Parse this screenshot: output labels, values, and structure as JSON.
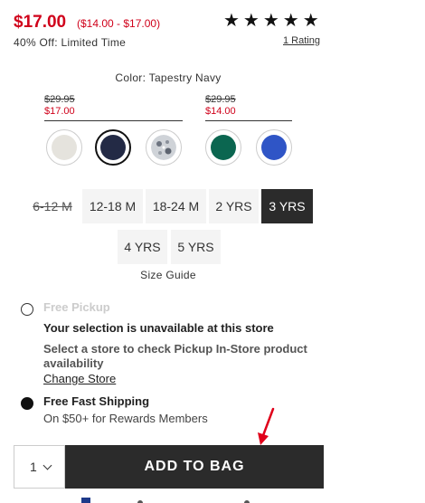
{
  "product": {
    "price": "$17.00",
    "price_range": "($14.00 - $17.00)",
    "discount": "40% Off: Limited Time",
    "stars": "★★★★★",
    "rating_value": 5,
    "rating_link": "1 Rating"
  },
  "color": {
    "label": "Color: Tapestry Navy",
    "groups": [
      {
        "old": "$29.95",
        "new": "$17.00"
      },
      {
        "old": "$29.95",
        "new": "$14.00"
      }
    ],
    "swatches": [
      {
        "name": "cream",
        "color": "#e5e3dd"
      },
      {
        "name": "tapestry-navy",
        "color": "#232a45",
        "selected": true
      },
      {
        "name": "pattern",
        "color": "#c9cdd2"
      },
      {
        "name": "green",
        "color": "#0b6650"
      },
      {
        "name": "blue",
        "color": "#2f55c6"
      }
    ]
  },
  "sizes": {
    "options": [
      "6-12 M",
      "12-18 M",
      "18-24 M",
      "2 YRS",
      "3 YRS",
      "4 YRS",
      "5 YRS"
    ],
    "unavailable": "6-12 M",
    "selected": "3 YRS",
    "guide": "Size Guide"
  },
  "fulfillment": {
    "pickup_title": "Free Pickup",
    "pickup_unavailable": "Your selection is unavailable at this store",
    "pickup_select": "Select a store to check Pickup In-Store product availability",
    "change_store": "Change Store",
    "shipping_title": "Free Fast Shipping",
    "shipping_sub": "On $50+ for Rewards Members"
  },
  "cart": {
    "quantity": "1",
    "add_to_bag": "ADD TO BAG"
  },
  "colors": {
    "sale_red": "#d0021b",
    "dark_button": "#2b2b2b",
    "annotation_arrow": "#e0001a"
  }
}
